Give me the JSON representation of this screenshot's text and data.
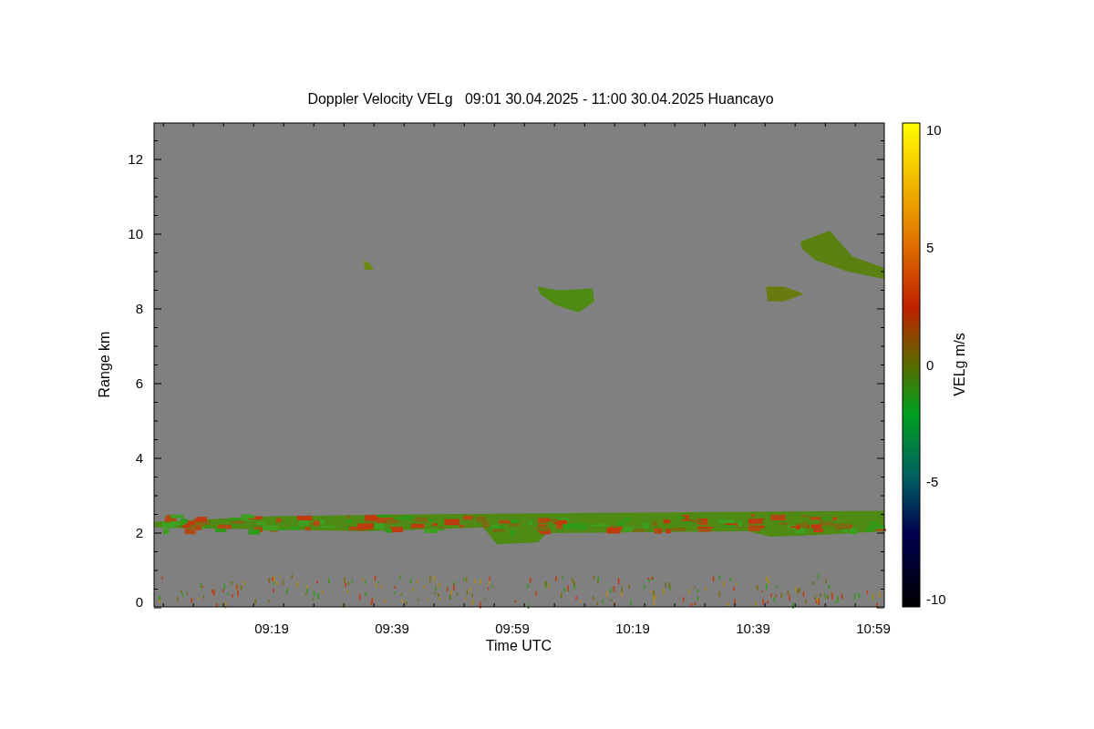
{
  "title": "Doppler Velocity VELg   09:01 30.04.2025 - 11:00 30.04.2025 Huancayo",
  "x_axis": {
    "label": "Time UTC",
    "ticks": [
      "09:19",
      "09:39",
      "09:59",
      "10:19",
      "10:39",
      "10:59"
    ]
  },
  "y_axis": {
    "label": "Range km",
    "ticks": [
      "12",
      "10",
      "8",
      "6",
      "4",
      "2",
      "0"
    ]
  },
  "colorbar": {
    "label": "VELg m/s",
    "ticks": [
      "10",
      "5",
      "0",
      "-5",
      "-10"
    ]
  }
}
